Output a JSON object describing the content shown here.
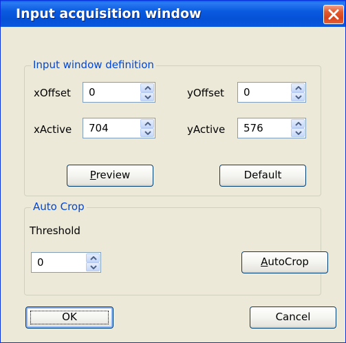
{
  "window": {
    "title": "Input acquisition window"
  },
  "input_group": {
    "legend": "Input window definition",
    "xoffset": {
      "label": "xOffset",
      "value": "0"
    },
    "yoffset": {
      "label": "yOffset",
      "value": "0"
    },
    "xactive": {
      "label": "xActive",
      "value": "704"
    },
    "yactive": {
      "label": "yActive",
      "value": "576"
    },
    "preview": {
      "label": "Preview",
      "mnemonic": "P",
      "rest": "review"
    },
    "default": {
      "label": "Default"
    }
  },
  "autocrop_group": {
    "legend": "Auto Crop",
    "threshold_label": "Threshold",
    "threshold_value": "0",
    "autocrop_button": {
      "label": "AutoCrop",
      "mnemonic": "A",
      "rest": "utoCrop"
    }
  },
  "footer": {
    "ok_label": "OK",
    "cancel_label": "Cancel"
  },
  "icons": {
    "close": "close-icon",
    "spin_up": "spin-up-icon",
    "spin_down": "spin-down-icon"
  }
}
